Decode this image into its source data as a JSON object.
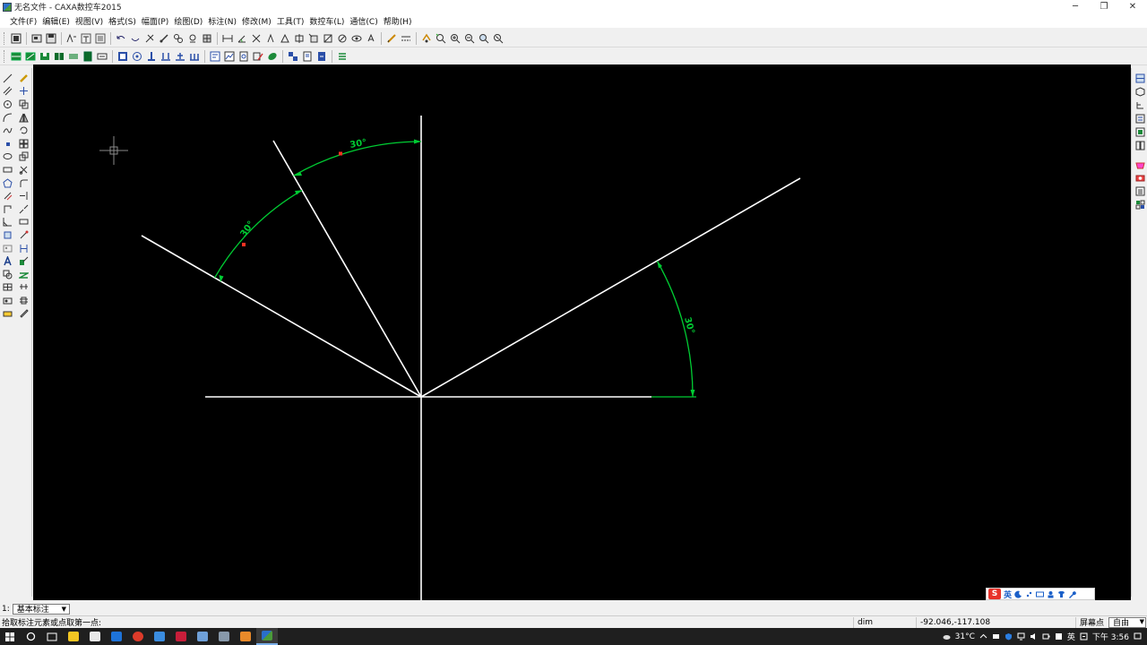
{
  "window": {
    "title": "无名文件 - CAXA数控车2015",
    "minimize_glyph": "─",
    "restore_glyph": "❐",
    "close_glyph": "✕"
  },
  "menu": [
    {
      "label": "文件(F)",
      "id": "file"
    },
    {
      "label": "编辑(E)",
      "id": "edit"
    },
    {
      "label": "视图(V)",
      "id": "view"
    },
    {
      "label": "格式(S)",
      "id": "format"
    },
    {
      "label": "幅面(P)",
      "id": "sheet"
    },
    {
      "label": "绘图(D)",
      "id": "draw"
    },
    {
      "label": "标注(N)",
      "id": "annotate"
    },
    {
      "label": "修改(M)",
      "id": "modify"
    },
    {
      "label": "工具(T)",
      "id": "tools"
    },
    {
      "label": "数控车(L)",
      "id": "nc-lathe"
    },
    {
      "label": "通信(C)",
      "id": "comm"
    },
    {
      "label": "帮助(H)",
      "id": "help"
    }
  ],
  "colors": {
    "canvas_bg": "#000000",
    "geometry": "#ffffff",
    "dimension": "#00cc33",
    "dim_point": "#ff3322",
    "cursor": "#8a8a8a"
  },
  "drawing": {
    "dimensions": [
      {
        "name": "angle-dim-top",
        "text": "30°"
      },
      {
        "name": "angle-dim-left",
        "text": "30°"
      },
      {
        "name": "angle-dim-right",
        "text": "30°"
      }
    ]
  },
  "ime": {
    "logo": "S",
    "lang": "英"
  },
  "command": {
    "prefix": "1:",
    "mode_value": "基本标注"
  },
  "status": {
    "prompt": "拾取标注元素或点取第一点:",
    "command_name": "dim",
    "coordinates": "-92.046,-117.108",
    "point_mode": "屏幕点",
    "snap_mode": "自由"
  },
  "taskbar": {
    "weather": "31°C",
    "tray_lang": "英",
    "clock": "下午 3:56"
  }
}
